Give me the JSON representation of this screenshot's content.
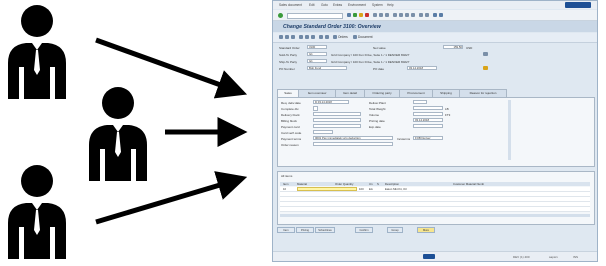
{
  "illustration": {
    "people": [
      {
        "name": "user-icon-1"
      },
      {
        "name": "user-icon-2"
      },
      {
        "name": "user-icon-3"
      }
    ],
    "arrows": 3
  },
  "sap": {
    "menu": [
      "Sales document",
      "Edit",
      "Goto",
      "Extras",
      "Environment",
      "System",
      "Help"
    ],
    "title": "Change Standard Order 3100: Overview",
    "app_toolbar": {
      "orders_label": "Orders",
      "document_label": "Document"
    },
    "header": {
      "standard_order_label": "Standard Order",
      "standard_order_value": "3100",
      "net_value_label": "Net value",
      "net_value_amount": "159.50",
      "currency": "USD",
      "sold_to_label": "Sold-To Party",
      "sold_to_value": "G1",
      "sold_to_desc": "Grid Company / 100 Fun Drive, Suite 1 / 1 DENVER 80227",
      "ship_to_label": "Ship-To Party",
      "ship_to_value": "G1",
      "ship_to_desc": "Grid Company / 100 Fun Drive, Suite 1 / 1 DENVER 80227",
      "po_label": "PO Number",
      "po_value": "Bob Fund",
      "po_date_label": "PO date",
      "po_date_value": "03.14.2018"
    },
    "tabs": [
      "Sales",
      "Item overview",
      "Item detail",
      "Ordering party",
      "Procurement",
      "Shipping",
      "Reason for rejection"
    ],
    "sales_tab": {
      "req_deliv_label": "Req. deliv.date",
      "req_deliv_value": "D  03.14.2018",
      "complete_dlv_label": "Complete dlv.",
      "delivery_block_label": "Delivery block",
      "billing_block_label": "Billing block",
      "payment_card_label": "Payment card",
      "card_verif_label": "Card verif.code",
      "payment_terms_label": "Payment terms",
      "payment_terms_value": "0001 Pay immediately w/o deduction",
      "order_reason_label": "Order reason",
      "deliver_plant_label": "Deliver.Plant",
      "total_weight_label": "Total Weight",
      "total_weight_unit": "LB",
      "volume_label": "Volume",
      "volume_unit": "FT3",
      "pricing_date_label": "Pricing date",
      "pricing_date_value": "03.14.2018",
      "exp_date_label": "Exp.date",
      "incoterms_label": "Incoterms",
      "incoterms_value": "FOB Denver"
    },
    "all_items": {
      "label": "All items",
      "columns": [
        "Item",
        "Material",
        "Order Quantity",
        "Un",
        "S",
        "Description",
        "Customer Material Numb"
      ],
      "rows": [
        {
          "item": "10",
          "material": "",
          "qty": "100",
          "unit": "EA",
          "desc": "Eaton Mkt Kit, Oil"
        }
      ]
    },
    "bottom_buttons": [
      "Item",
      "Pricing",
      "Sched.lines",
      "Confirm",
      "Group",
      "More"
    ],
    "status": {
      "system": "DEV (1) 400",
      "server": "sapsrv",
      "mode": "INS"
    }
  }
}
